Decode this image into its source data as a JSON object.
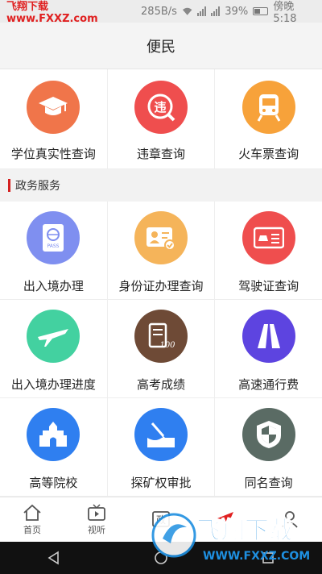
{
  "status_bar": {
    "watermark": "飞翔下载 www.FXXZ.com",
    "speed": "285B/s",
    "battery_pct": "39%",
    "time": "傍晚5:18"
  },
  "header": {
    "title": "便民"
  },
  "top_services": [
    {
      "label": "学位真实性查询",
      "icon": "graduation-cap-icon",
      "color": "#f0754a"
    },
    {
      "label": "违章查询",
      "icon": "violation-search-icon",
      "color": "#ef4e4e"
    },
    {
      "label": "火车票查询",
      "icon": "train-icon",
      "color": "#f7a23a"
    }
  ],
  "section": {
    "title": "政务服务",
    "accent": "#d42020"
  },
  "gov_services": [
    {
      "label": "出入境办理",
      "icon": "passport-icon",
      "color": "#7f8ff0"
    },
    {
      "label": "身份证办理查询",
      "icon": "id-card-icon",
      "color": "#f5b45a"
    },
    {
      "label": "驾驶证查询",
      "icon": "driver-license-icon",
      "color": "#ef4e4e"
    },
    {
      "label": "出入境办理进度",
      "icon": "airplane-icon",
      "color": "#43d1a0"
    },
    {
      "label": "高考成绩",
      "icon": "exam-score-icon",
      "color": "#6e4a36"
    },
    {
      "label": "高速通行费",
      "icon": "highway-icon",
      "color": "#5d44e0"
    },
    {
      "label": "高等院校",
      "icon": "university-icon",
      "color": "#2f7ff0"
    },
    {
      "label": "探矿权审批",
      "icon": "shovel-icon",
      "color": "#2f7ff0"
    },
    {
      "label": "同名查询",
      "icon": "shield-icon",
      "color": "#5a6b64"
    }
  ],
  "tabs": [
    {
      "label": "首页",
      "icon": "home-icon"
    },
    {
      "label": "视听",
      "icon": "tv-icon"
    },
    {
      "label": "",
      "icon": "gov-icon"
    },
    {
      "label": "",
      "icon": "send-icon"
    },
    {
      "label": "",
      "icon": "user-icon"
    }
  ],
  "watermark_bottom": {
    "text_cn": "飞翔下载",
    "text_en": "WWW.FXXZ.COM"
  }
}
